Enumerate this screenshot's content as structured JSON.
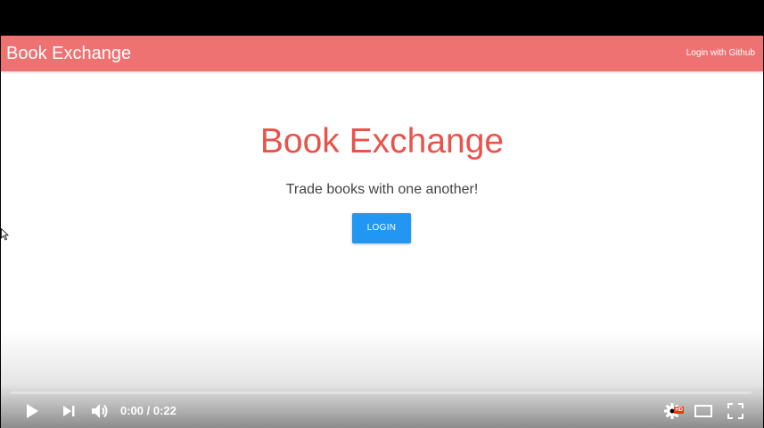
{
  "app": {
    "brand": "Book Exchange",
    "nav_link": "Login with Github"
  },
  "hero": {
    "title": "Book Exchange",
    "subtitle": "Trade books with one another!",
    "login_label": "LOGIN"
  },
  "player": {
    "time": "0:00 / 0:22",
    "progress": 0,
    "hd_badge": "HD",
    "controls": {
      "play": "play-icon",
      "next": "next-icon",
      "volume": "volume-icon",
      "settings": "settings-gear-icon",
      "theater": "theater-mode-icon",
      "fullscreen": "fullscreen-icon"
    }
  },
  "colors": {
    "navbar": "#ee7272",
    "title": "#e8534b",
    "button": "#2196f3"
  }
}
